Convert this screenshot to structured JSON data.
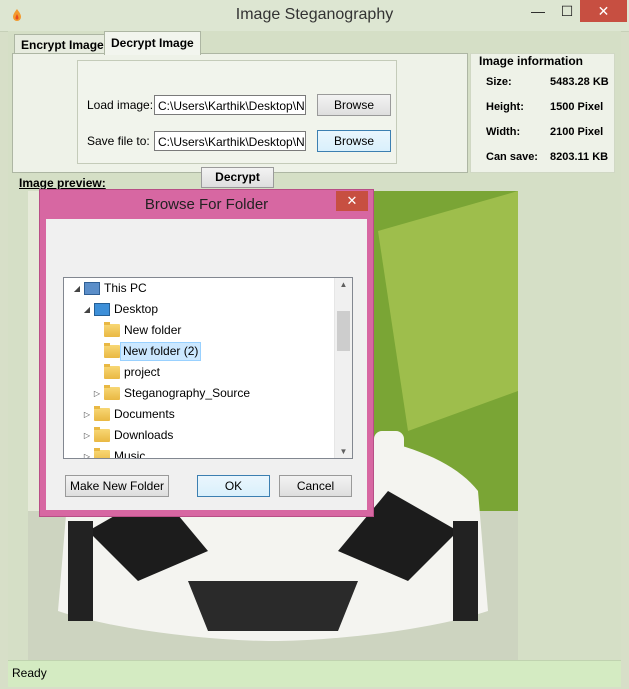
{
  "window": {
    "title": "Image  Steganography",
    "min_glyph": "—",
    "max_glyph": "☐",
    "close_glyph": "✕"
  },
  "tabs": [
    {
      "label": "Encrypt Image"
    },
    {
      "label": "Decrypt Image"
    }
  ],
  "decrypt": {
    "load_label": "Load image:",
    "load_value": "C:\\Users\\Karthik\\Desktop\\New",
    "save_label": "Save file to:",
    "save_value": "C:\\Users\\Karthik\\Desktop\\New",
    "browse_label": "Browse",
    "decrypt_label": "Decrypt"
  },
  "image_info": {
    "title": "Image information",
    "rows": [
      {
        "key": "Size:",
        "value": "5483.28 KB"
      },
      {
        "key": "Height:",
        "value": "1500 Pixel"
      },
      {
        "key": "Width:",
        "value": "2100 Pixel"
      },
      {
        "key": "Can save:",
        "value": "8203.11 KB"
      }
    ]
  },
  "preview_label": "Image preview:",
  "status": "Ready",
  "dialog": {
    "title": "Browse For Folder",
    "close_glyph": "✕",
    "tree": [
      {
        "label": "This PC",
        "expander": "◢",
        "icon": "computer-icon"
      },
      {
        "label": "Desktop",
        "expander": "◢",
        "icon": "desktop-folder-icon"
      },
      {
        "label": "New folder",
        "expander": "",
        "icon": "folder-icon"
      },
      {
        "label": "New folder (2)",
        "expander": "",
        "icon": "folder-icon",
        "selected": true
      },
      {
        "label": "project",
        "expander": "",
        "icon": "folder-icon"
      },
      {
        "label": "Steganography_Source",
        "expander": "▷",
        "icon": "folder-icon"
      },
      {
        "label": "Documents",
        "expander": "▷",
        "icon": "documents-folder-icon"
      },
      {
        "label": "Downloads",
        "expander": "▷",
        "icon": "downloads-folder-icon"
      },
      {
        "label": "Music",
        "expander": "▷",
        "icon": "music-folder-icon"
      }
    ],
    "make_new_folder_label": "Make New Folder",
    "ok_label": "OK",
    "cancel_label": "Cancel"
  },
  "colors": {
    "dialog_frame": "#d767a2",
    "close_red": "#c74f41",
    "status_bar": "#d4ebc2"
  }
}
